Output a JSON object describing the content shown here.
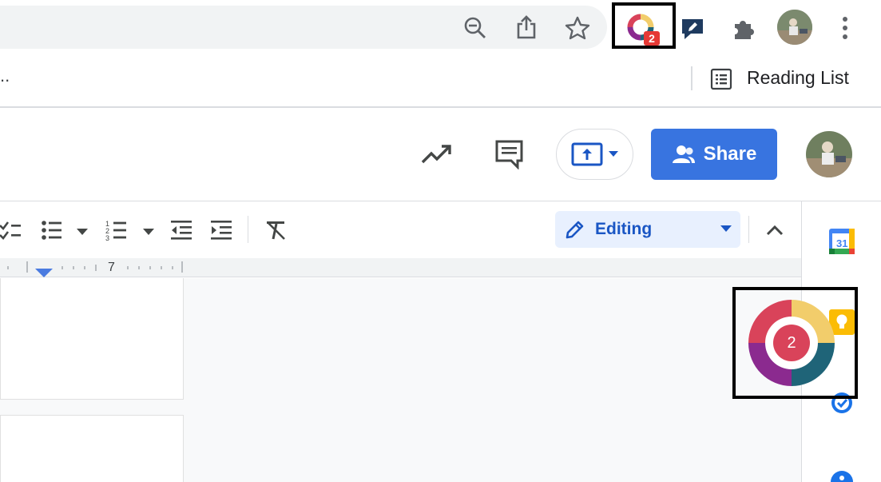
{
  "browser": {
    "omnibar_icons": [
      "zoom-out-icon",
      "share-icon",
      "bookmark-star-icon"
    ],
    "extension_badge": "2",
    "bookmarks_ellipsis": "..",
    "reading_list_label": "Reading List"
  },
  "docs_header": {
    "share_label": "Share"
  },
  "toolbar": {
    "editing_mode_label": "Editing",
    "ruler_mark": "7"
  },
  "extension_panel": {
    "badge_count": "2",
    "colors": {
      "red": "#d9435a",
      "yellow": "#f2cd6b",
      "teal": "#1f6478",
      "purple": "#8b2a8f"
    }
  },
  "colors": {
    "accent": "#3874e0",
    "editing_bg": "#e8f0fe",
    "editing_text": "#1a56c4"
  }
}
